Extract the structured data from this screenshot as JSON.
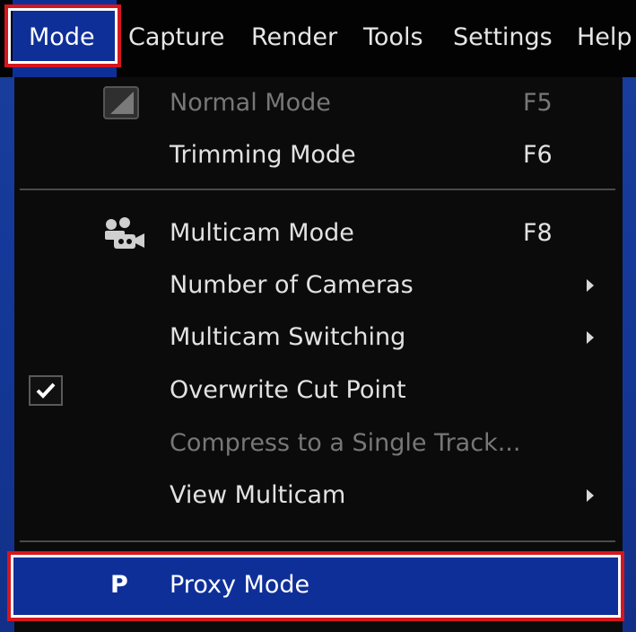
{
  "menubar": {
    "items": [
      {
        "label": "Mode"
      },
      {
        "label": "Capture"
      },
      {
        "label": "Render"
      },
      {
        "label": "Tools"
      },
      {
        "label": "Settings"
      },
      {
        "label": "Help"
      }
    ]
  },
  "mode_menu": {
    "items": [
      {
        "label": "Normal Mode",
        "shortcut": "F5",
        "icon": "normal-mode-icon",
        "state": "disabled"
      },
      {
        "label": "Trimming Mode",
        "shortcut": "F6"
      },
      {
        "label": "Multicam Mode",
        "shortcut": "F8",
        "icon": "multicam-icon"
      },
      {
        "label": "Number of Cameras",
        "submenu": true
      },
      {
        "label": "Multicam Switching",
        "submenu": true
      },
      {
        "label": "Overwrite Cut Point",
        "checked": true
      },
      {
        "label": "Compress to a Single Track...",
        "state": "disabled"
      },
      {
        "label": "View Multicam",
        "submenu": true
      },
      {
        "label": "Proxy Mode",
        "icon_text": "P",
        "highlighted": true
      }
    ]
  },
  "colors": {
    "highlight": "#0f2f98",
    "annotation_box": "#d6161f",
    "menu_background": "#0b0b0b"
  }
}
